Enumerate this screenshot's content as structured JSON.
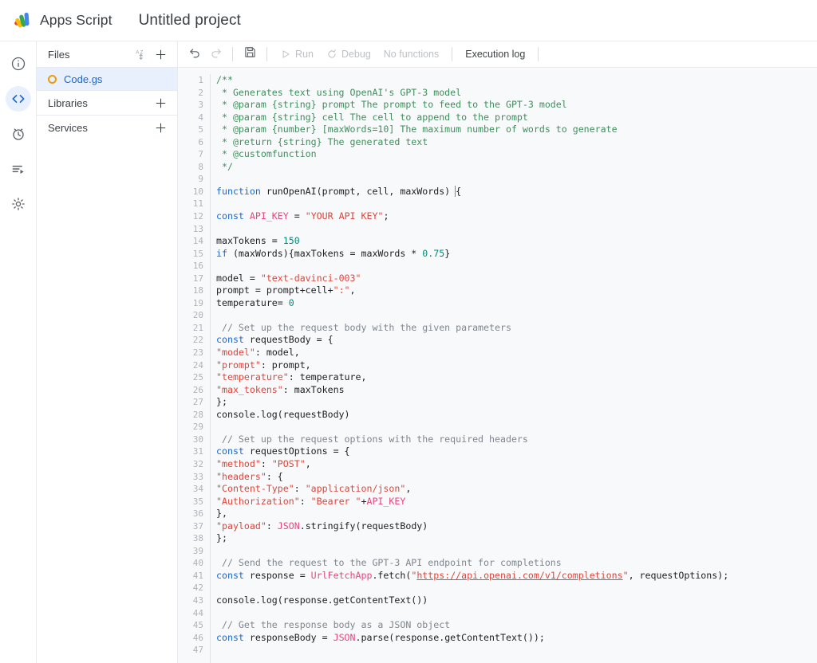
{
  "header": {
    "logo_name": "apps-script-logo",
    "app_name": "Apps Script",
    "project_name": "Untitled project"
  },
  "rail": {
    "items": [
      {
        "icon": "info-icon",
        "name": "overview",
        "active": false
      },
      {
        "icon": "code-icon",
        "name": "editor",
        "active": true
      },
      {
        "icon": "clock-icon",
        "name": "triggers",
        "active": false
      },
      {
        "icon": "executions-icon",
        "name": "executions",
        "active": false
      },
      {
        "icon": "gear-icon",
        "name": "project-settings",
        "active": false
      }
    ]
  },
  "files_panel": {
    "title": "Files",
    "sort_icon": "sort-az-icon",
    "add_icon": "plus-icon",
    "files": [
      {
        "name": "Code.gs",
        "icon": "script-file-icon",
        "selected": true
      }
    ],
    "sections": [
      {
        "title": "Libraries",
        "add_icon": "plus-icon"
      },
      {
        "title": "Services",
        "add_icon": "plus-icon"
      }
    ]
  },
  "toolbar": {
    "undo_label": "undo-icon",
    "redo_label": "redo-icon",
    "save_label": "save-icon",
    "run_label": "Run",
    "debug_label": "Debug",
    "functions_label": "No functions",
    "execution_log_label": "Execution log"
  },
  "editor": {
    "first_line": 1,
    "last_line": 47,
    "total_lines": 47,
    "cursor_line": 10,
    "colors": {
      "comment": "#3f8f5b",
      "line_comment": "#7f868d",
      "keyword": "#1967d2",
      "string": "#e0453b",
      "number": "#00897b",
      "identifier": "#e8467c",
      "plain": "#202124",
      "background": "#f8f9fb",
      "gutter": "#aeb3b9"
    },
    "lines": [
      [
        {
          "t": "/**",
          "c": "c-comment"
        }
      ],
      [
        {
          "t": " * Generates text using OpenAI's GPT-3 model",
          "c": "c-comment"
        }
      ],
      [
        {
          "t": " * @param {string} prompt The prompt to feed to the GPT-3 model",
          "c": "c-comment"
        }
      ],
      [
        {
          "t": " * @param {string} cell The cell to append to the prompt",
          "c": "c-comment"
        }
      ],
      [
        {
          "t": " * @param {number} [maxWords=10] The maximum number of words to generate",
          "c": "c-comment"
        }
      ],
      [
        {
          "t": " * @return {string} The generated text",
          "c": "c-comment"
        }
      ],
      [
        {
          "t": " * @customfunction",
          "c": "c-comment"
        }
      ],
      [
        {
          "t": " */",
          "c": "c-comment"
        }
      ],
      [],
      [
        {
          "t": "function",
          "c": "c-kw"
        },
        {
          "t": " runOpenAI(prompt, cell, maxWords) ",
          "c": "c-plain"
        },
        {
          "t": "{",
          "c": "c-plain cursor-box"
        }
      ],
      [],
      [
        {
          "t": "const",
          "c": "c-kw"
        },
        {
          "t": " ",
          "c": "c-plain"
        },
        {
          "t": "API_KEY",
          "c": "c-ident"
        },
        {
          "t": " = ",
          "c": "c-plain"
        },
        {
          "t": "\"YOUR API KEY\"",
          "c": "c-str"
        },
        {
          "t": ";",
          "c": "c-plain"
        }
      ],
      [],
      [
        {
          "t": "maxTokens = ",
          "c": "c-plain"
        },
        {
          "t": "150",
          "c": "c-num"
        }
      ],
      [
        {
          "t": "if",
          "c": "c-kw"
        },
        {
          "t": " (maxWords){maxTokens = maxWords * ",
          "c": "c-plain"
        },
        {
          "t": "0.75",
          "c": "c-num"
        },
        {
          "t": "}",
          "c": "c-plain"
        }
      ],
      [],
      [
        {
          "t": "model = ",
          "c": "c-plain"
        },
        {
          "t": "\"text-davinci-003\"",
          "c": "c-str"
        }
      ],
      [
        {
          "t": "prompt = prompt+cell+",
          "c": "c-plain"
        },
        {
          "t": "\":\"",
          "c": "c-str"
        },
        {
          "t": ",",
          "c": "c-plain"
        }
      ],
      [
        {
          "t": "temperature= ",
          "c": "c-plain"
        },
        {
          "t": "0",
          "c": "c-num"
        }
      ],
      [],
      [
        {
          "t": " // Set up the request body with the given parameters",
          "c": "c-slash"
        }
      ],
      [
        {
          "t": "const",
          "c": "c-kw"
        },
        {
          "t": " requestBody = {",
          "c": "c-plain"
        }
      ],
      [
        {
          "t": "\"model\"",
          "c": "c-str"
        },
        {
          "t": ": model,",
          "c": "c-plain"
        }
      ],
      [
        {
          "t": "\"prompt\"",
          "c": "c-str"
        },
        {
          "t": ": prompt,",
          "c": "c-plain"
        }
      ],
      [
        {
          "t": "\"temperature\"",
          "c": "c-str"
        },
        {
          "t": ": temperature,",
          "c": "c-plain"
        }
      ],
      [
        {
          "t": "\"max_tokens\"",
          "c": "c-str"
        },
        {
          "t": ": maxTokens",
          "c": "c-plain"
        }
      ],
      [
        {
          "t": "};",
          "c": "c-plain"
        }
      ],
      [
        {
          "t": "console.log(requestBody)",
          "c": "c-plain"
        }
      ],
      [],
      [
        {
          "t": " // Set up the request options with the required headers",
          "c": "c-slash"
        }
      ],
      [
        {
          "t": "const",
          "c": "c-kw"
        },
        {
          "t": " requestOptions = {",
          "c": "c-plain"
        }
      ],
      [
        {
          "t": "\"method\"",
          "c": "c-str"
        },
        {
          "t": ": ",
          "c": "c-plain"
        },
        {
          "t": "\"POST\"",
          "c": "c-str"
        },
        {
          "t": ",",
          "c": "c-plain"
        }
      ],
      [
        {
          "t": "\"headers\"",
          "c": "c-str"
        },
        {
          "t": ": {",
          "c": "c-plain"
        }
      ],
      [
        {
          "t": "\"Content-Type\"",
          "c": "c-str"
        },
        {
          "t": ": ",
          "c": "c-plain"
        },
        {
          "t": "\"application/json\"",
          "c": "c-str"
        },
        {
          "t": ",",
          "c": "c-plain"
        }
      ],
      [
        {
          "t": "\"Authorization\"",
          "c": "c-str"
        },
        {
          "t": ": ",
          "c": "c-plain"
        },
        {
          "t": "\"Bearer \"",
          "c": "c-str"
        },
        {
          "t": "+",
          "c": "c-plain"
        },
        {
          "t": "API_KEY",
          "c": "c-ident"
        }
      ],
      [
        {
          "t": "},",
          "c": "c-plain"
        }
      ],
      [
        {
          "t": "\"payload\"",
          "c": "c-str"
        },
        {
          "t": ": ",
          "c": "c-plain"
        },
        {
          "t": "JSON",
          "c": "c-ident"
        },
        {
          "t": ".stringify(requestBody)",
          "c": "c-plain"
        }
      ],
      [
        {
          "t": "};",
          "c": "c-plain"
        }
      ],
      [],
      [
        {
          "t": " // Send the request to the GPT-3 API endpoint for completions",
          "c": "c-slash"
        }
      ],
      [
        {
          "t": "const",
          "c": "c-kw"
        },
        {
          "t": " response = ",
          "c": "c-plain"
        },
        {
          "t": "UrlFetchApp",
          "c": "c-ident"
        },
        {
          "t": ".fetch(",
          "c": "c-plain"
        },
        {
          "t": "\"",
          "c": "c-str"
        },
        {
          "t": "https://api.openai.com/v1/completions",
          "c": "c-link"
        },
        {
          "t": "\"",
          "c": "c-str"
        },
        {
          "t": ", requestOptions);",
          "c": "c-plain"
        }
      ],
      [],
      [
        {
          "t": "console.log(response.getContentText())",
          "c": "c-plain"
        }
      ],
      [],
      [
        {
          "t": " // Get the response body as a JSON object",
          "c": "c-slash"
        }
      ],
      [
        {
          "t": "const",
          "c": "c-kw"
        },
        {
          "t": " responseBody = ",
          "c": "c-plain"
        },
        {
          "t": "JSON",
          "c": "c-ident"
        },
        {
          "t": ".parse(response.getContentText());",
          "c": "c-plain"
        }
      ],
      []
    ]
  }
}
